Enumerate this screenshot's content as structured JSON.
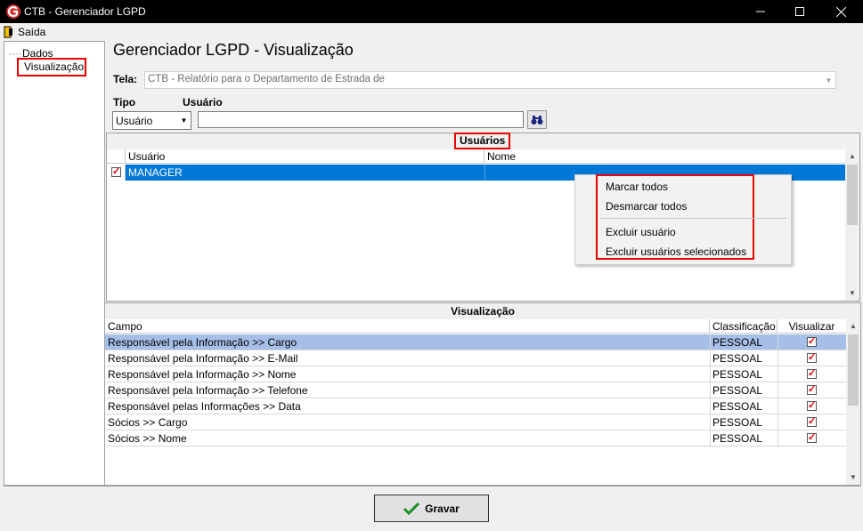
{
  "window": {
    "title": "CTB - Gerenciador LGPD"
  },
  "menu": {
    "items": [
      {
        "label": "Saída"
      }
    ]
  },
  "tree": {
    "items": [
      {
        "label": "Dados"
      },
      {
        "label": "Visualização"
      }
    ]
  },
  "page": {
    "heading": "Gerenciador LGPD - Visualização"
  },
  "tela": {
    "label": "Tela:",
    "value": "CTB - Relatório para o Departamento de Estrada de"
  },
  "filters": {
    "tipo_label": "Tipo",
    "tipo_value": "Usuário",
    "usuario_label": "Usuário",
    "usuario_value": ""
  },
  "users_section": {
    "title": "Usuários",
    "columns": [
      "Usuário",
      "Nome"
    ],
    "rows": [
      {
        "usuario": "MANAGER",
        "nome": "",
        "checked": true,
        "selected": true
      }
    ]
  },
  "context_menu": {
    "items": [
      "Marcar todos",
      "Desmarcar todos",
      "Excluir usuário",
      "Excluir usuários selecionados"
    ]
  },
  "view_section": {
    "title": "Visualização",
    "columns": [
      "Campo",
      "Classificação",
      "Visualizar"
    ],
    "rows": [
      {
        "campo": "Responsável pela Informação >> Cargo",
        "classificacao": "PESSOAL",
        "visualizar": true
      },
      {
        "campo": "Responsável pela Informação >> E-Mail",
        "classificacao": "PESSOAL",
        "visualizar": true
      },
      {
        "campo": "Responsável pela Informação >> Nome",
        "classificacao": "PESSOAL",
        "visualizar": true
      },
      {
        "campo": "Responsável pela Informação >> Telefone",
        "classificacao": "PESSOAL",
        "visualizar": true
      },
      {
        "campo": "Responsável pelas Informações >> Data",
        "classificacao": "PESSOAL",
        "visualizar": true
      },
      {
        "campo": "Sócios >> Cargo",
        "classificacao": "PESSOAL",
        "visualizar": true
      },
      {
        "campo": "Sócios >> Nome",
        "classificacao": "PESSOAL",
        "visualizar": true
      }
    ]
  },
  "footer": {
    "save_label": "Gravar"
  },
  "colors": {
    "selection": "#0078d7",
    "row_highlight": "#a6bfe8",
    "highlight_box": "#e00000",
    "titlebar": "#000000"
  }
}
